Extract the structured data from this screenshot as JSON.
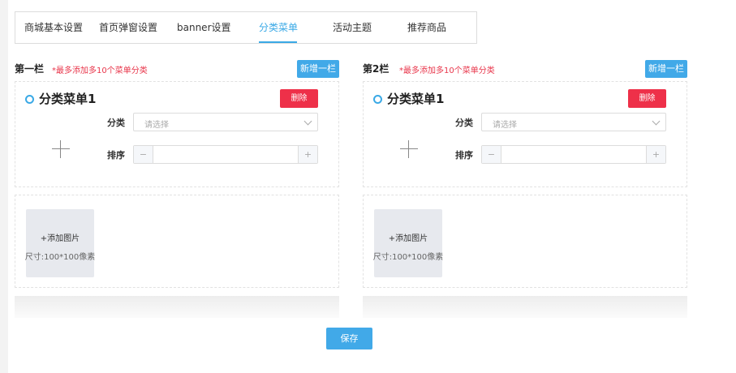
{
  "tabs": [
    {
      "label": "商城基本设置"
    },
    {
      "label": "首页弹窗设置"
    },
    {
      "label": "banner设置"
    },
    {
      "label": "分类菜单"
    },
    {
      "label": "活动主题"
    },
    {
      "label": "推荐商品"
    }
  ],
  "active_tab": "分类菜单",
  "columns": [
    {
      "title": "第一栏",
      "hint": "*最多添加多10个菜单分类",
      "add_button": "新增一栏",
      "menu": {
        "title": "分类菜单1",
        "delete_button": "删除",
        "category_label": "分类",
        "category_placeholder": "请选择",
        "sort_label": "排序",
        "minus": "−",
        "plus": "+"
      },
      "image": {
        "add_label": "+添加图片",
        "size_label": "尺寸:100*100像素"
      }
    },
    {
      "title": "第2栏",
      "hint": "*最多添加多10个菜单分类",
      "add_button": "新增一栏",
      "menu": {
        "title": "分类菜单1",
        "delete_button": "删除",
        "category_label": "分类",
        "category_placeholder": "请选择",
        "sort_label": "排序",
        "minus": "−",
        "plus": "+"
      },
      "image": {
        "add_label": "+添加图片",
        "size_label": "尺寸:100*100像素"
      }
    }
  ],
  "save_button": "保存",
  "colors": {
    "accent": "#41a9e8",
    "danger": "#ee3049",
    "hint": "#e8364b"
  }
}
